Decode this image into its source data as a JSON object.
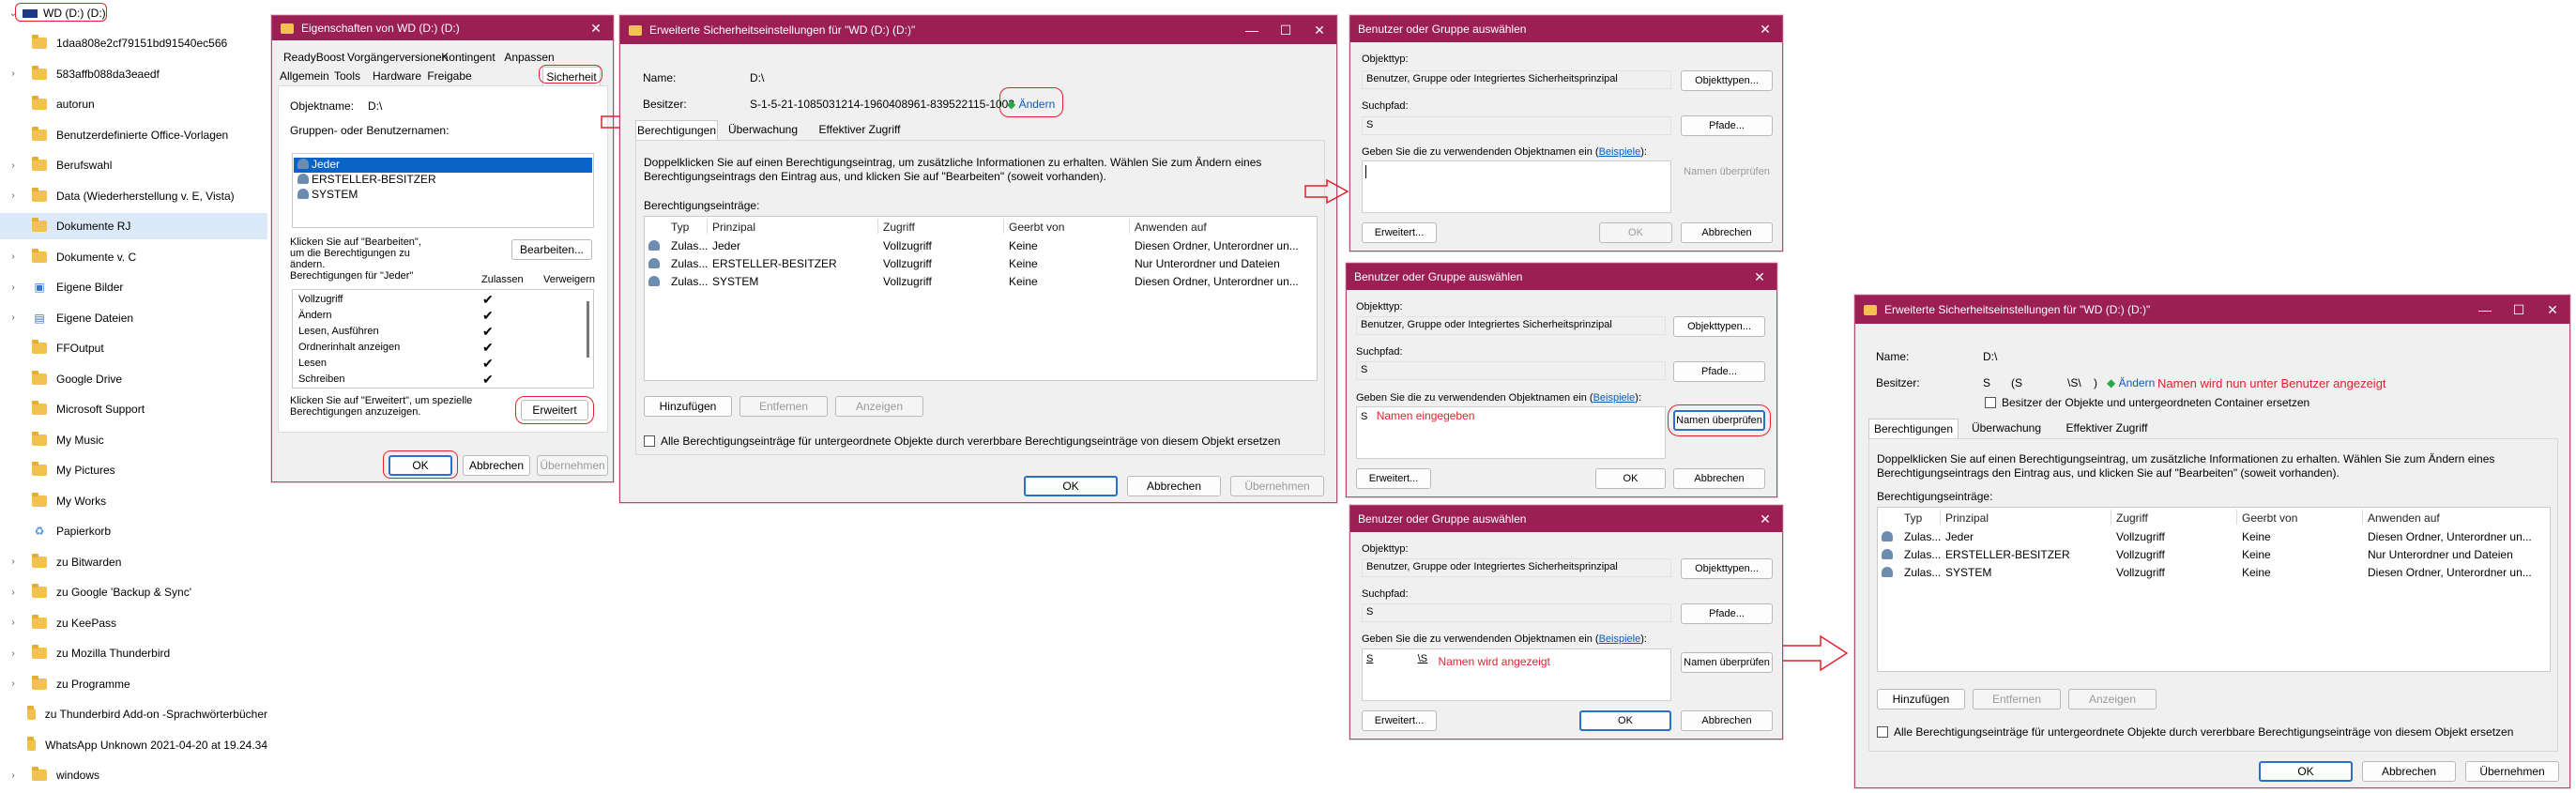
{
  "tree": {
    "root": "WD (D:) (D:)",
    "items": [
      {
        "label": "1daa808e2cf79151bd91540ec566",
        "chev": false,
        "icon": "folder"
      },
      {
        "label": "583affb088da3eaedf",
        "chev": true,
        "icon": "folder"
      },
      {
        "label": "autorun",
        "chev": false,
        "icon": "folder"
      },
      {
        "label": "Benutzerdefinierte Office-Vorlagen",
        "chev": false,
        "icon": "folder"
      },
      {
        "label": "Berufswahl",
        "chev": true,
        "icon": "folder"
      },
      {
        "label": "Data (Wiederherstellung v. E, Vista)",
        "chev": true,
        "icon": "folder"
      },
      {
        "label": "Dokumente RJ",
        "chev": false,
        "icon": "folder",
        "selected": true
      },
      {
        "label": "Dokumente v. C",
        "chev": true,
        "icon": "folder"
      },
      {
        "label": "Eigene Bilder",
        "chev": true,
        "icon": "picture"
      },
      {
        "label": "Eigene Dateien",
        "chev": true,
        "icon": "document"
      },
      {
        "label": "FFOutput",
        "chev": false,
        "icon": "folder"
      },
      {
        "label": "Google Drive",
        "chev": false,
        "icon": "folder"
      },
      {
        "label": "Microsoft Support",
        "chev": false,
        "icon": "folder"
      },
      {
        "label": "My Music",
        "chev": false,
        "icon": "folder"
      },
      {
        "label": "My Pictures",
        "chev": false,
        "icon": "folder"
      },
      {
        "label": "My Works",
        "chev": false,
        "icon": "folder"
      },
      {
        "label": "Papierkorb",
        "chev": false,
        "icon": "recycle"
      },
      {
        "label": "zu Bitwarden",
        "chev": true,
        "icon": "folder"
      },
      {
        "label": "zu Google 'Backup & Sync'",
        "chev": true,
        "icon": "folder"
      },
      {
        "label": "zu KeePass",
        "chev": true,
        "icon": "folder"
      },
      {
        "label": "zu Mozilla Thunderbird",
        "chev": true,
        "icon": "folder"
      },
      {
        "label": "zu Programme",
        "chev": true,
        "icon": "folder"
      },
      {
        "label": "zu Thunderbird Add-on -Sprachwörterbücher",
        "chev": false,
        "icon": "folder"
      },
      {
        "label": "WhatsApp Unknown 2021-04-20 at 19.24.34",
        "chev": false,
        "icon": "folder"
      },
      {
        "label": "windows",
        "chev": true,
        "icon": "folder"
      }
    ]
  },
  "props": {
    "title": "Eigenschaften von WD (D:) (D:)",
    "tabs_row1": [
      "ReadyBoost",
      "Vorgängerversionen",
      "Kontingent",
      "Anpassen"
    ],
    "tabs_row2": [
      "Allgemein",
      "Tools",
      "Hardware",
      "Freigabe",
      "Sicherheit"
    ],
    "objname_label": "Objektname:",
    "objname": "D:\\",
    "groups_label": "Gruppen- oder Benutzernamen:",
    "users": [
      "Jeder",
      "ERSTELLER-BESITZER",
      "SYSTEM"
    ],
    "edit_hint": "Klicken Sie auf \"Bearbeiten\", um die Berechtigungen zu ändern.",
    "edit_btn": "Bearbeiten...",
    "perm_for": "Berechtigungen für \"Jeder\"",
    "allow": "Zulassen",
    "deny": "Verweigern",
    "perms": [
      "Vollzugriff",
      "Ändern",
      "Lesen, Ausführen",
      "Ordnerinhalt anzeigen",
      "Lesen",
      "Schreiben"
    ],
    "adv_hint": "Klicken Sie auf \"Erweitert\", um spezielle Berechtigungen anzuzeigen.",
    "adv_btn": "Erweitert",
    "ok": "OK",
    "cancel": "Abbrechen",
    "apply": "Übernehmen"
  },
  "adv": {
    "title": "Erweiterte Sicherheitseinstellungen für \"WD (D:) (D:)\"",
    "name_label": "Name:",
    "name": "D:\\",
    "owner_label": "Besitzer:",
    "owner": "S-1-5-21-1085031214-1960408961-839522115-1003",
    "change": "Ändern",
    "tabs": [
      "Berechtigungen",
      "Überwachung",
      "Effektiver Zugriff"
    ],
    "info": "Doppelklicken Sie auf einen Berechtigungseintrag, um zusätzliche Informationen zu erhalten. Wählen Sie zum Ändern eines Berechtigungseintrags den Eintrag aus, und klicken Sie auf \"Bearbeiten\" (soweit vorhanden).",
    "entries_label": "Berechtigungseinträge:",
    "cols": [
      "Typ",
      "Prinzipal",
      "Zugriff",
      "Geerbt von",
      "Anwenden auf"
    ],
    "rows": [
      [
        "Zulas...",
        "Jeder",
        "Vollzugriff",
        "Keine",
        "Diesen Ordner, Unterordner un..."
      ],
      [
        "Zulas...",
        "ERSTELLER-BESITZER",
        "Vollzugriff",
        "Keine",
        "Nur Unterordner und Dateien"
      ],
      [
        "Zulas...",
        "SYSTEM",
        "Vollzugriff",
        "Keine",
        "Diesen Ordner, Unterordner un..."
      ]
    ],
    "add": "Hinzufügen",
    "remove": "Entfernen",
    "view": "Anzeigen",
    "replace": "Alle Berechtigungseinträge für untergeordnete Objekte durch vererbbare Berechtigungseinträge von diesem Objekt ersetzen",
    "ok": "OK",
    "cancel": "Abbrechen",
    "apply": "Übernehmen"
  },
  "sel": {
    "title": "Benutzer oder Gruppe auswählen",
    "objtype_label": "Objekttyp:",
    "objtype": "Benutzer, Gruppe oder Integriertes Sicherheitsprinzipal",
    "objtype_btn": "Objekttypen...",
    "path_label": "Suchpfad:",
    "path": "S",
    "path_btn": "Pfade...",
    "enter_label_a": "Geben Sie die zu verwendenden Objektnamen ein (",
    "enter_link": "Beispiele",
    "enter_label_b": "):",
    "check_btn": "Namen überprüfen",
    "adv_btn": "Erweitert...",
    "ok": "OK",
    "cancel": "Abbrechen",
    "entered2": "S",
    "annot2": "Namen eingegeben",
    "entered3a": "S",
    "entered3b": "\\S",
    "annot3": "Namen wird angezeigt"
  },
  "adv2": {
    "title": "Erweiterte Sicherheitseinstellungen für \"WD (D:) (D:)\"",
    "name_label": "Name:",
    "name": "D:\\",
    "owner_label": "Besitzer:",
    "owner_a": "S",
    "owner_b": "(S",
    "owner_c": "\\S\\",
    "owner_d": ")",
    "change": "Ändern",
    "annot": "Namen wird nun unter Benutzer angezeigt",
    "replace_owner": "Besitzer der Objekte und untergeordneten Container ersetzen",
    "win_min": "—",
    "win_max": "☐",
    "win_close": "✕"
  }
}
